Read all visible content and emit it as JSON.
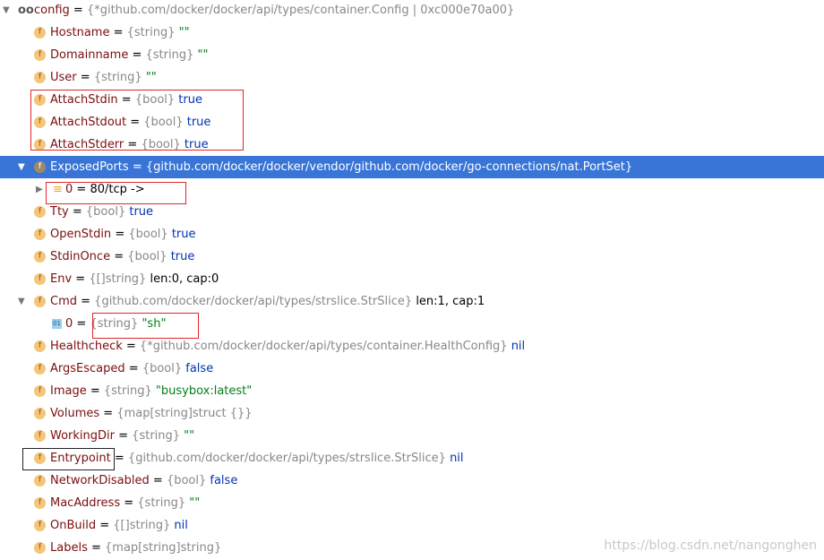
{
  "rows": [
    {
      "level": 0,
      "arrow": "expanded",
      "icon": "watch",
      "segs": [
        [
          "name",
          "config"
        ],
        [
          "op",
          " = "
        ],
        [
          "type",
          "{*github.com/docker/docker/api/types/container.Config | 0xc000e70a00}"
        ]
      ]
    },
    {
      "level": 1,
      "icon": "field",
      "segs": [
        [
          "name",
          "Hostname"
        ],
        [
          "op",
          " = "
        ],
        [
          "type",
          "{string} "
        ],
        [
          "str",
          "\"\""
        ]
      ]
    },
    {
      "level": 1,
      "icon": "field",
      "segs": [
        [
          "name",
          "Domainname"
        ],
        [
          "op",
          " = "
        ],
        [
          "type",
          "{string} "
        ],
        [
          "str",
          "\"\""
        ]
      ]
    },
    {
      "level": 1,
      "icon": "field",
      "segs": [
        [
          "name",
          "User"
        ],
        [
          "op",
          " = "
        ],
        [
          "type",
          "{string} "
        ],
        [
          "str",
          "\"\""
        ]
      ]
    },
    {
      "level": 1,
      "icon": "field",
      "segs": [
        [
          "name",
          "AttachStdin"
        ],
        [
          "op",
          " = "
        ],
        [
          "type",
          "{bool} "
        ],
        [
          "kw",
          "true"
        ]
      ]
    },
    {
      "level": 1,
      "icon": "field",
      "segs": [
        [
          "name",
          "AttachStdout"
        ],
        [
          "op",
          " = "
        ],
        [
          "type",
          "{bool} "
        ],
        [
          "kw",
          "true"
        ]
      ]
    },
    {
      "level": 1,
      "icon": "field",
      "segs": [
        [
          "name",
          "AttachStderr"
        ],
        [
          "op",
          " = "
        ],
        [
          "type",
          "{bool} "
        ],
        [
          "kw",
          "true"
        ]
      ]
    },
    {
      "level": 1,
      "arrow": "expanded",
      "icon": "field",
      "selected": true,
      "segs": [
        [
          "name",
          "ExposedPorts"
        ],
        [
          "op",
          " = "
        ],
        [
          "type",
          "{github.com/docker/docker/vendor/github.com/docker/go-connections/nat.PortSet}"
        ]
      ]
    },
    {
      "level": 2,
      "arrow": "collapsed",
      "icon": "list",
      "segs": [
        [
          "name",
          "0"
        ],
        [
          "op",
          " = "
        ],
        [
          "plain",
          "80/tcp ->"
        ]
      ]
    },
    {
      "level": 1,
      "icon": "field",
      "segs": [
        [
          "name",
          "Tty"
        ],
        [
          "op",
          " = "
        ],
        [
          "type",
          "{bool} "
        ],
        [
          "kw",
          "true"
        ]
      ]
    },
    {
      "level": 1,
      "icon": "field",
      "segs": [
        [
          "name",
          "OpenStdin"
        ],
        [
          "op",
          " = "
        ],
        [
          "type",
          "{bool} "
        ],
        [
          "kw",
          "true"
        ]
      ]
    },
    {
      "level": 1,
      "icon": "field",
      "segs": [
        [
          "name",
          "StdinOnce"
        ],
        [
          "op",
          " = "
        ],
        [
          "type",
          "{bool} "
        ],
        [
          "kw",
          "true"
        ]
      ]
    },
    {
      "level": 1,
      "icon": "field",
      "segs": [
        [
          "name",
          "Env"
        ],
        [
          "op",
          " = "
        ],
        [
          "type",
          "{[]string} "
        ],
        [
          "plain",
          "len:0, cap:0"
        ]
      ]
    },
    {
      "level": 1,
      "arrow": "expanded",
      "icon": "field",
      "segs": [
        [
          "name",
          "Cmd"
        ],
        [
          "op",
          " = "
        ],
        [
          "type",
          "{github.com/docker/docker/api/types/strslice.StrSlice} "
        ],
        [
          "plain",
          "len:1, cap:1"
        ]
      ]
    },
    {
      "level": 2,
      "icon": "index",
      "segs": [
        [
          "name",
          "0"
        ],
        [
          "op",
          " = "
        ],
        [
          "type",
          "{string} "
        ],
        [
          "str",
          "\"sh\""
        ]
      ]
    },
    {
      "level": 1,
      "icon": "field",
      "segs": [
        [
          "name",
          "Healthcheck"
        ],
        [
          "op",
          " = "
        ],
        [
          "type",
          "{*github.com/docker/docker/api/types/container.HealthConfig} "
        ],
        [
          "kw",
          "nil"
        ]
      ]
    },
    {
      "level": 1,
      "icon": "field",
      "segs": [
        [
          "name",
          "ArgsEscaped"
        ],
        [
          "op",
          " = "
        ],
        [
          "type",
          "{bool} "
        ],
        [
          "kw",
          "false"
        ]
      ]
    },
    {
      "level": 1,
      "icon": "field",
      "segs": [
        [
          "name",
          "Image"
        ],
        [
          "op",
          " = "
        ],
        [
          "type",
          "{string} "
        ],
        [
          "str",
          "\"busybox:latest\""
        ]
      ]
    },
    {
      "level": 1,
      "icon": "field",
      "segs": [
        [
          "name",
          "Volumes"
        ],
        [
          "op",
          " = "
        ],
        [
          "type",
          "{map[string]struct {}}"
        ]
      ]
    },
    {
      "level": 1,
      "icon": "field",
      "segs": [
        [
          "name",
          "WorkingDir"
        ],
        [
          "op",
          " = "
        ],
        [
          "type",
          "{string} "
        ],
        [
          "str",
          "\"\""
        ]
      ]
    },
    {
      "level": 1,
      "icon": "field",
      "segs": [
        [
          "name",
          "Entrypoint"
        ],
        [
          "op",
          " = "
        ],
        [
          "type",
          "{github.com/docker/docker/api/types/strslice.StrSlice} "
        ],
        [
          "kw",
          "nil"
        ]
      ]
    },
    {
      "level": 1,
      "icon": "field",
      "segs": [
        [
          "name",
          "NetworkDisabled"
        ],
        [
          "op",
          " = "
        ],
        [
          "type",
          "{bool} "
        ],
        [
          "kw",
          "false"
        ]
      ]
    },
    {
      "level": 1,
      "icon": "field",
      "segs": [
        [
          "name",
          "MacAddress"
        ],
        [
          "op",
          " = "
        ],
        [
          "type",
          "{string} "
        ],
        [
          "str",
          "\"\""
        ]
      ]
    },
    {
      "level": 1,
      "icon": "field",
      "segs": [
        [
          "name",
          "OnBuild"
        ],
        [
          "op",
          " = "
        ],
        [
          "type",
          "{[]string} "
        ],
        [
          "kw",
          "nil"
        ]
      ]
    },
    {
      "level": 1,
      "icon": "field",
      "segs": [
        [
          "name",
          "Labels"
        ],
        [
          "op",
          " = "
        ],
        [
          "type",
          "{map[string]string}"
        ]
      ]
    }
  ],
  "icons": {
    "field": "f",
    "list": "≡",
    "index": "01",
    "watch": "oo"
  },
  "watermark": "https://blog.csdn.net/nangonghen",
  "colors": {
    "selection": "#3875d7",
    "highlight_box": "#e0262b"
  }
}
